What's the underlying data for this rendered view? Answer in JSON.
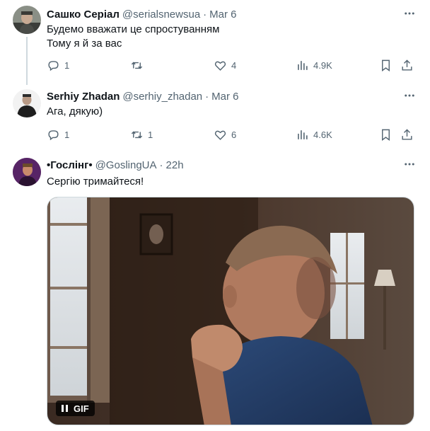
{
  "tweets": [
    {
      "name": "Сашко Серіал",
      "handle": "@serialsnewsua",
      "dot": "·",
      "time": "Mar 6",
      "lines": [
        "Будемо вважати це спростуванням",
        "Тому я й за вас"
      ],
      "replies": "1",
      "retweets": "",
      "likes": "4",
      "views": "4.9K"
    },
    {
      "name": "Serhiy Zhadan",
      "handle": "@serhiy_zhadan",
      "dot": "·",
      "time": "Mar 6",
      "lines": [
        "Ага, дякую)"
      ],
      "replies": "1",
      "retweets": "1",
      "likes": "6",
      "views": "4.6K"
    },
    {
      "name": "•Гослінг•",
      "handle": "@GoslingUA",
      "dot": "·",
      "time": "22h",
      "lines": [
        "Сергію тримайтеся!"
      ],
      "media": {
        "badge": "GIF"
      }
    }
  ],
  "icons": {
    "reply": "reply-icon",
    "retweet": "retweet-icon",
    "like": "heart-icon",
    "views": "views-icon",
    "bookmark": "bookmark-icon",
    "share": "share-icon",
    "more": "more-icon",
    "pause": "pause-icon"
  },
  "colors": {
    "text": "#0f1419",
    "secondary": "#536471",
    "thread_line": "#cfd9de"
  }
}
